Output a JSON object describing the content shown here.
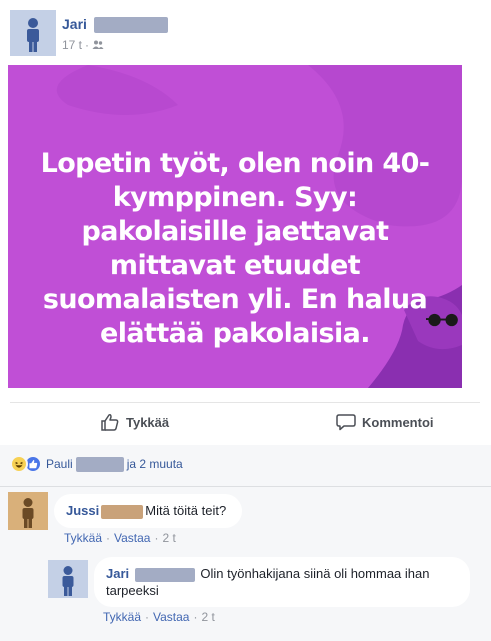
{
  "post": {
    "author_first_name": "Jari",
    "time": "17 t",
    "separator": "·",
    "audience_icon": "friends-icon",
    "image_text": "Lopetin työt, olen noin 40-kymppinen. Syy: pakolaisille jaettavat mittavat etuudet suomalaisten yli. En halua elättää pakolaisia.",
    "colors": {
      "image_bg": "#c04fd6",
      "image_bg_dark": "#a036c4",
      "image_shape": "#8a2fb0"
    }
  },
  "actions": {
    "like_label": "Tykkää",
    "comment_label": "Kommentoi"
  },
  "reactions": {
    "icons": [
      "haha-reaction-icon",
      "like-reaction-icon"
    ],
    "first_name": "Pauli",
    "rest_text": "ja 2 muuta"
  },
  "comments": [
    {
      "author_first_name": "Jussi",
      "text": "Mitä töitä teit?",
      "like_label": "Tykkää",
      "reply_label": "Vastaa",
      "time": "2 t"
    },
    {
      "author_first_name": "Jari",
      "text": "Olin työnhakijana siinä oli hommaa ihan tarpeeksi",
      "like_label": "Tykkää",
      "reply_label": "Vastaa",
      "time": "2 t"
    }
  ],
  "ui": {
    "dot": "·"
  }
}
